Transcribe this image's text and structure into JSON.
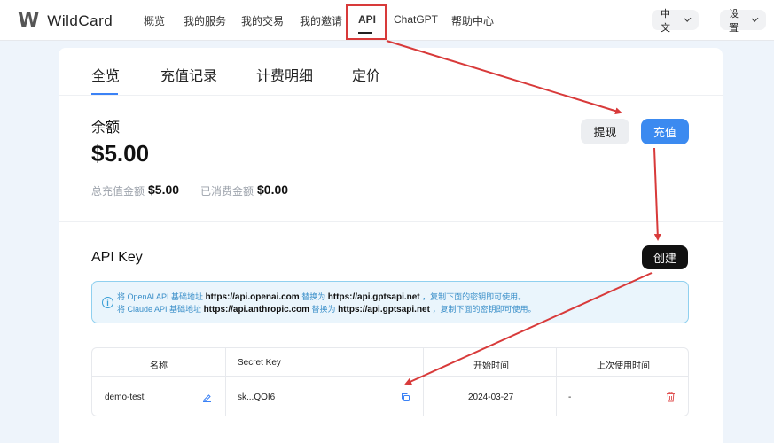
{
  "header": {
    "logo_mark": "W",
    "logo_text": "WildCard",
    "nav": [
      "概览",
      "我的服务",
      "我的交易",
      "我的邀请",
      "API",
      "ChatGPT",
      "帮助中心"
    ],
    "language": "中文",
    "settings": "设置"
  },
  "tabs": [
    "全览",
    "充值记录",
    "计费明细",
    "定价"
  ],
  "balance": {
    "title": "余额",
    "amount": "$5.00",
    "total_recharge_label": "总充值金额",
    "total_recharge_value": "$5.00",
    "consumed_label": "已消费金额",
    "consumed_value": "$0.00",
    "withdraw_label": "提现",
    "recharge_label": "充值"
  },
  "api_key": {
    "title": "API Key",
    "create_label": "创建",
    "info": {
      "line1_prefix": "将 OpenAI API 基础地址",
      "line1_from": "https://api.openai.com",
      "line1_mid": "替换为",
      "line1_to": "https://api.gptsapi.net",
      "line1_suffix": "，复制下面的密钥即可使用。",
      "line2_prefix": "将 Claude API 基础地址",
      "line2_from": "https://api.anthropic.com",
      "line2_mid": "替换为",
      "line2_to": "https://api.gptsapi.net",
      "line2_suffix": "，复制下面的密钥即可使用。"
    },
    "table": {
      "headers": [
        "名称",
        "Secret Key",
        "开始时间",
        "上次使用时间"
      ],
      "rows": [
        {
          "name": "demo-test",
          "secret_key": "sk...QOI6",
          "start_time": "2024-03-27",
          "last_used": "-"
        }
      ]
    }
  },
  "colors": {
    "accent_blue": "#3b8af0",
    "annotation_red": "#d83a3a",
    "info_border": "#8fd0ef"
  }
}
